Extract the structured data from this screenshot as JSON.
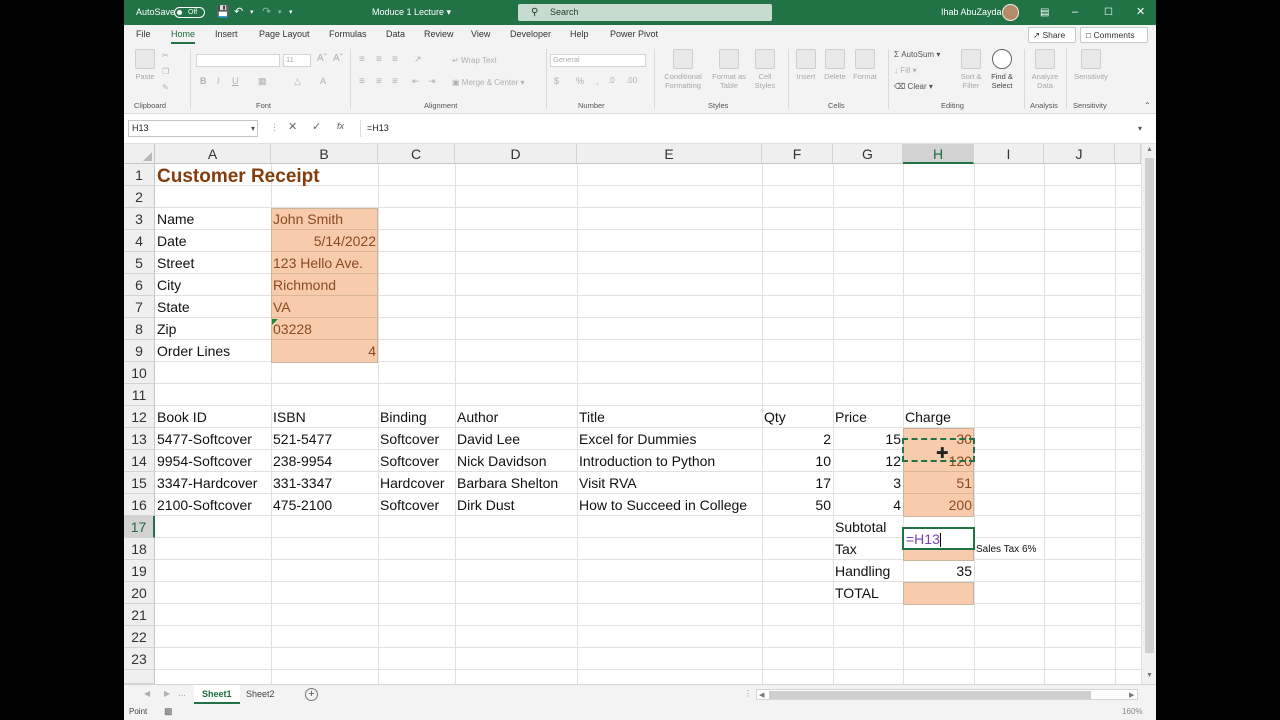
{
  "titlebar": {
    "autosave_label": "AutoSave",
    "autosave_state": "Off",
    "document_title": "Moduce 1 Lecture",
    "search_placeholder": "Search",
    "user_name": "Ihab AbuZayda"
  },
  "ribbon_tabs": [
    "File",
    "Home",
    "Insert",
    "Page Layout",
    "Formulas",
    "Data",
    "Review",
    "View",
    "Developer",
    "Help",
    "Power Pivot"
  ],
  "active_tab": "Home",
  "share_label": "Share",
  "comments_label": "Comments",
  "ribbon": {
    "groups": [
      "Clipboard",
      "Font",
      "Alignment",
      "Number",
      "Styles",
      "Cells",
      "Editing",
      "Analysis",
      "Sensitivity"
    ],
    "paste": "Paste",
    "font_name": "",
    "font_size": "11",
    "wrap_text": "Wrap Text",
    "merge_center": "Merge & Center",
    "number_format": "General",
    "conditional_formatting": "Conditional Formatting",
    "format_as_table": "Format as Table",
    "cell_styles": "Cell Styles",
    "insert": "Insert",
    "delete": "Delete",
    "format": "Format",
    "autosum": "AutoSum",
    "fill": "Fill",
    "clear": "Clear",
    "sort_filter": "Sort & Filter",
    "find_select": "Find & Select",
    "analyze_data": "Analyze Data",
    "sensitivity": "Sensitivity"
  },
  "formula_bar": {
    "name_box": "H13",
    "formula": "=H13"
  },
  "columns": [
    "A",
    "B",
    "C",
    "D",
    "E",
    "F",
    "G",
    "H",
    "I",
    "J"
  ],
  "selected_column": "H",
  "rows": [
    "1",
    "2",
    "3",
    "4",
    "5",
    "6",
    "7",
    "8",
    "9",
    "10",
    "11",
    "12",
    "13",
    "14",
    "15",
    "16",
    "17",
    "18",
    "19",
    "20",
    "21",
    "22",
    "23"
  ],
  "selected_row": "17",
  "sheet": {
    "title": "Customer Receipt",
    "customer": [
      {
        "label": "Name",
        "value": "John Smith"
      },
      {
        "label": "Date",
        "value": "5/14/2022"
      },
      {
        "label": "Street",
        "value": "123 Hello Ave."
      },
      {
        "label": "City",
        "value": "Richmond"
      },
      {
        "label": "State",
        "value": "VA"
      },
      {
        "label": "Zip",
        "value": "03228"
      },
      {
        "label": "Order Lines",
        "value": "4"
      }
    ],
    "headers": [
      "Book ID",
      "ISBN",
      "Binding",
      "Author",
      "Title",
      "Qty",
      "Price",
      "Charge"
    ],
    "lines": [
      {
        "book_id": "5477-Softcover",
        "isbn": "521-5477",
        "binding": "Softcover",
        "author": "David Lee",
        "title": "Excel for Dummies",
        "qty": "2",
        "price": "15",
        "charge": "30"
      },
      {
        "book_id": "9954-Softcover",
        "isbn": "238-9954",
        "binding": "Softcover",
        "author": "Nick Davidson",
        "title": "Introduction to Python",
        "qty": "10",
        "price": "12",
        "charge": "120"
      },
      {
        "book_id": "3347-Hardcover",
        "isbn": "331-3347",
        "binding": "Hardcover",
        "author": "Barbara Shelton",
        "title": "Visit RVA",
        "qty": "17",
        "price": "3",
        "charge": "51"
      },
      {
        "book_id": "2100-Softcover",
        "isbn": "475-2100",
        "binding": "Softcover",
        "author": "Dirk Dust",
        "title": "How to Succeed in College",
        "qty": "50",
        "price": "4",
        "charge": "200"
      }
    ],
    "subtotal_label": "Subtotal",
    "subtotal_editing": "=H13",
    "tax_label": "Tax",
    "tax_note": "Sales Tax 6%",
    "handling_label": "Handling",
    "handling_value": "35",
    "total_label": "TOTAL"
  },
  "sheet_tabs": [
    "Sheet1",
    "Sheet2"
  ],
  "active_sheet": "Sheet1",
  "status": {
    "mode": "Point",
    "zoom": "160%"
  }
}
